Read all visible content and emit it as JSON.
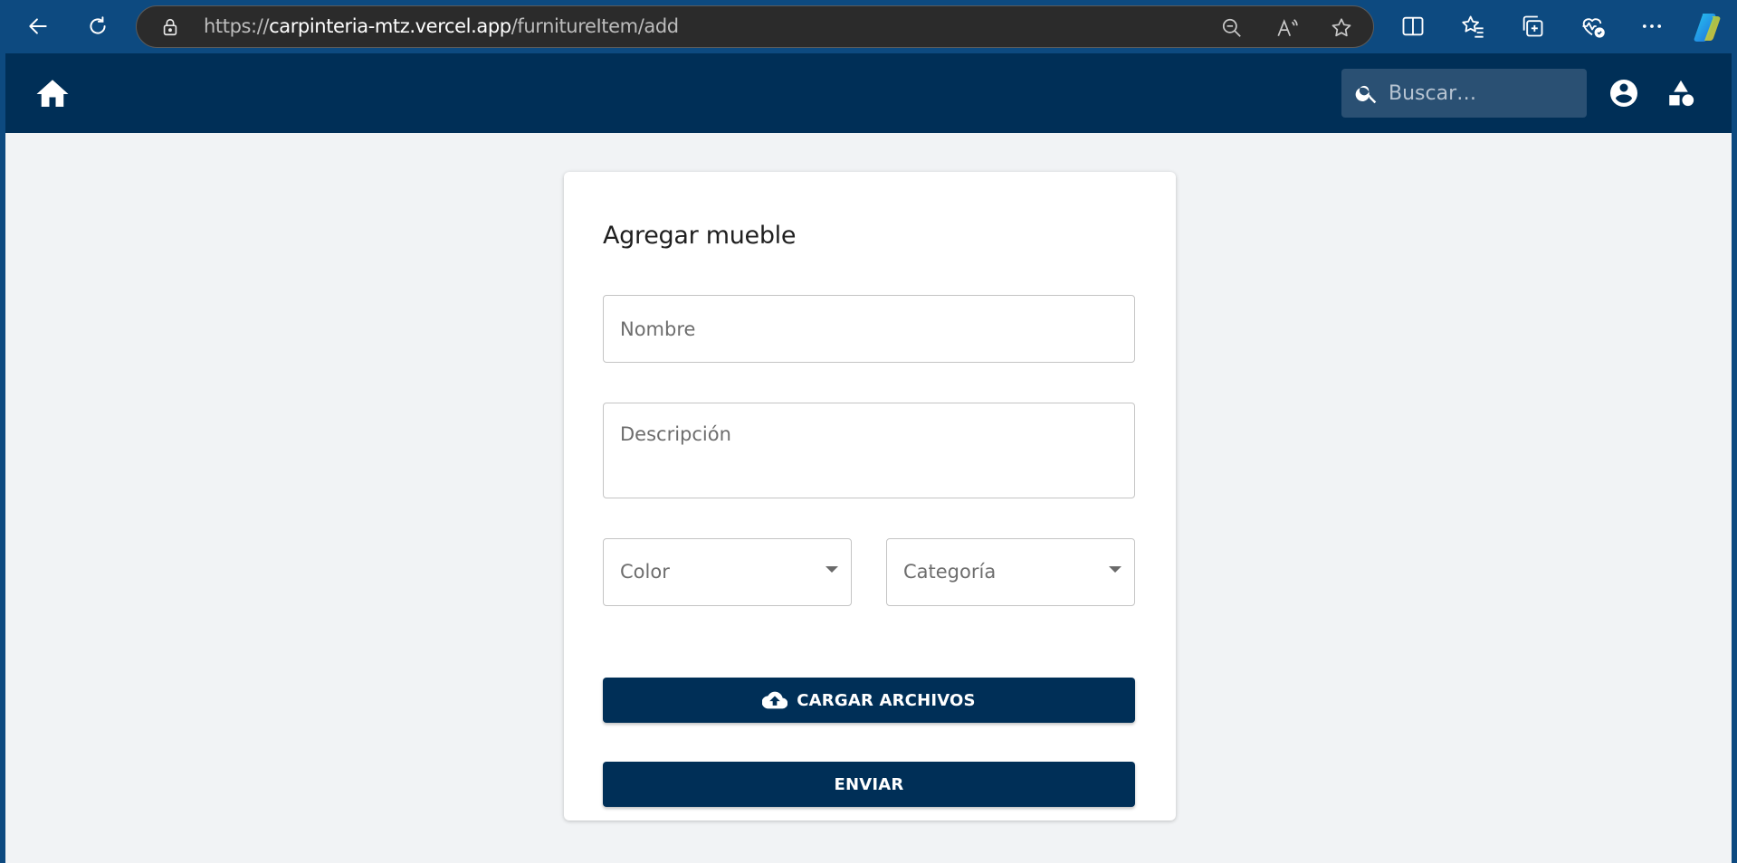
{
  "browser": {
    "url_prefix": "https://",
    "url_host": "carpinteria-mtz.vercel.app",
    "url_path": "/furnitureItem/add",
    "icons": [
      "back-icon",
      "refresh-icon",
      "lock-icon",
      "zoom-out-icon",
      "read-aloud-icon",
      "favorite-star-icon",
      "split-screen-icon",
      "favorites-list-icon",
      "collections-icon",
      "browser-essentials-icon",
      "more-icon",
      "copilot-icon"
    ]
  },
  "header": {
    "search_placeholder": "Buscar…",
    "icons": [
      "home-icon",
      "search-icon",
      "account-circle-icon",
      "category-shapes-icon"
    ]
  },
  "form": {
    "title": "Agregar mueble",
    "name_placeholder": "Nombre",
    "description_placeholder": "Descripción",
    "color_label": "Color",
    "category_label": "Categoría",
    "upload_label": "CARGAR ARCHIVOS",
    "submit_label": "ENVIAR"
  },
  "colors": {
    "browser_frame": "#0d4a80",
    "header": "#002f57",
    "page_bg": "#f1f3f5",
    "button": "#002f57"
  }
}
